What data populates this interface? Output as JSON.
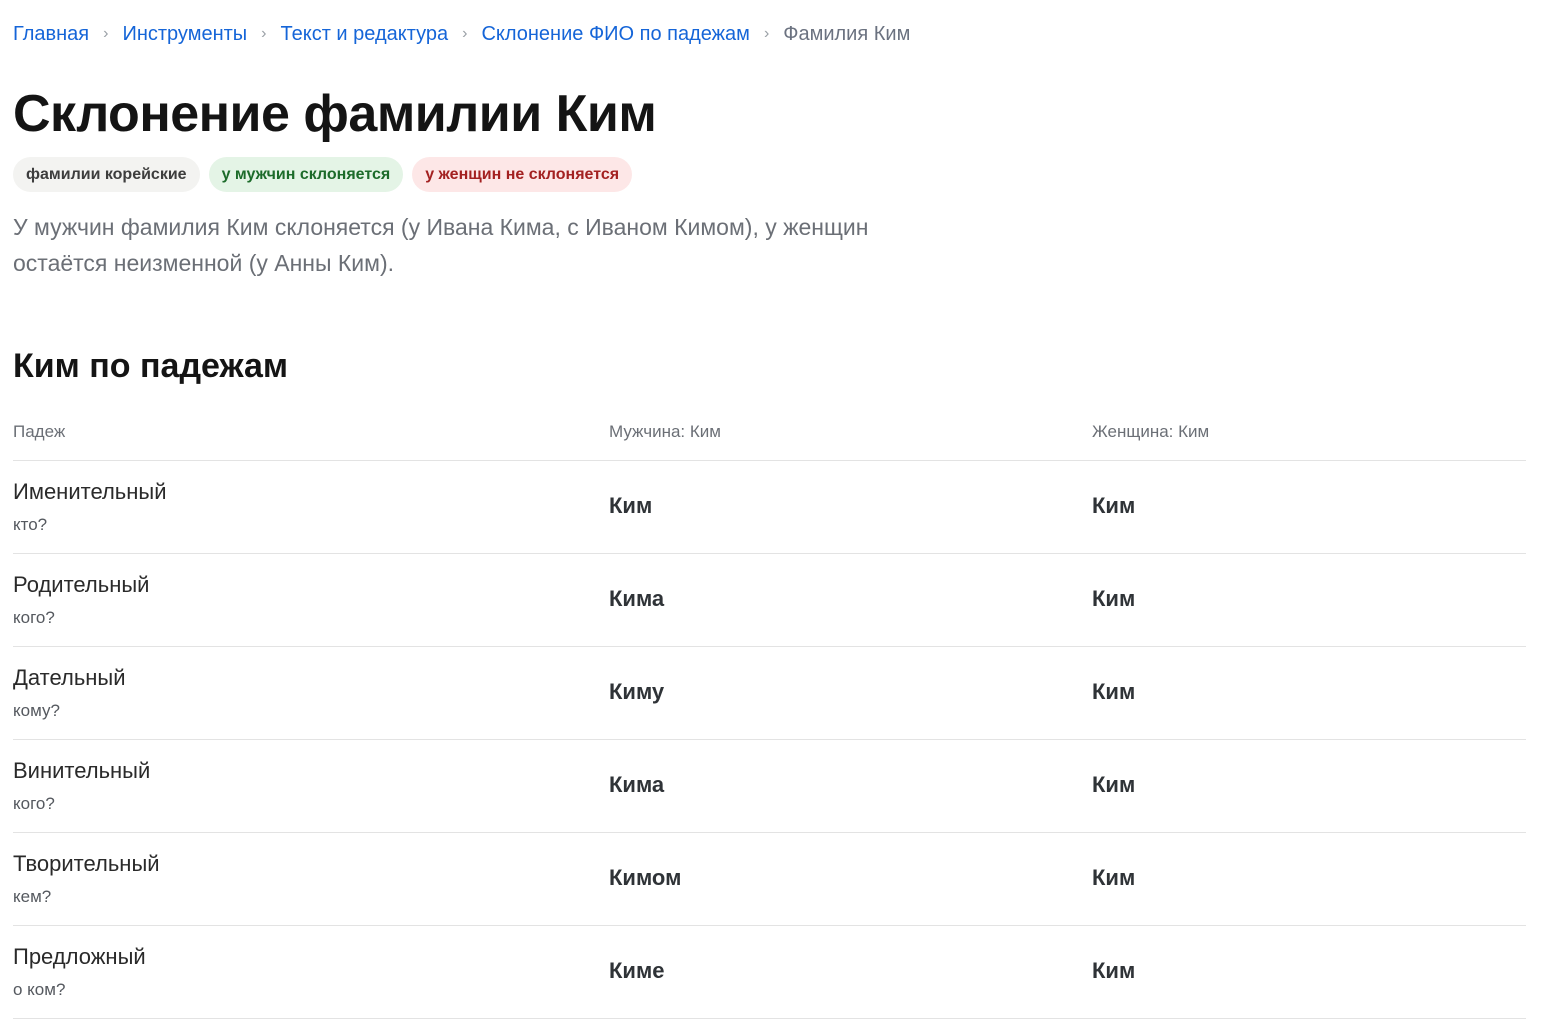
{
  "breadcrumb": {
    "items": [
      {
        "label": "Главная",
        "link": true
      },
      {
        "label": "Инструменты",
        "link": true
      },
      {
        "label": "Текст и редактура",
        "link": true
      },
      {
        "label": "Склонение ФИО по падежам",
        "link": true
      },
      {
        "label": "Фамилия Ким",
        "link": false
      }
    ],
    "separator": "›"
  },
  "title": "Склонение фамилии Ким",
  "tags": [
    {
      "label": "фамилии корейские",
      "style": "neutral"
    },
    {
      "label": "у мужчин склоняется",
      "style": "green"
    },
    {
      "label": "у женщин не склоняется",
      "style": "red"
    }
  ],
  "description": "У мужчин фамилия Ким склоняется (у Ивана Кима, с Иваном Кимом), у женщин остаётся неизменной (у Анны Ким).",
  "section_title": "Ким по падежам",
  "table": {
    "headers": {
      "case": "Падеж",
      "male": "Мужчина: Ким",
      "female": "Женщина: Ким"
    },
    "rows": [
      {
        "case": "Именительный",
        "question": "кто?",
        "male": "Ким",
        "female": "Ким"
      },
      {
        "case": "Родительный",
        "question": "кого?",
        "male": "Кима",
        "female": "Ким"
      },
      {
        "case": "Дательный",
        "question": "кому?",
        "male": "Киму",
        "female": "Ким"
      },
      {
        "case": "Винительный",
        "question": "кого?",
        "male": "Кима",
        "female": "Ким"
      },
      {
        "case": "Творительный",
        "question": "кем?",
        "male": "Кимом",
        "female": "Ким"
      },
      {
        "case": "Предложный",
        "question": "о ком?",
        "male": "Киме",
        "female": "Ким"
      }
    ]
  },
  "colors": {
    "link": "#1565d8",
    "text": "#141414",
    "muted": "#6b6f76",
    "tag_neutral_bg": "#f3f3f1",
    "tag_green_bg": "#e4f4e6",
    "tag_green_text": "#1c6b2a",
    "tag_red_bg": "#fde7e7",
    "tag_red_text": "#a32121"
  }
}
